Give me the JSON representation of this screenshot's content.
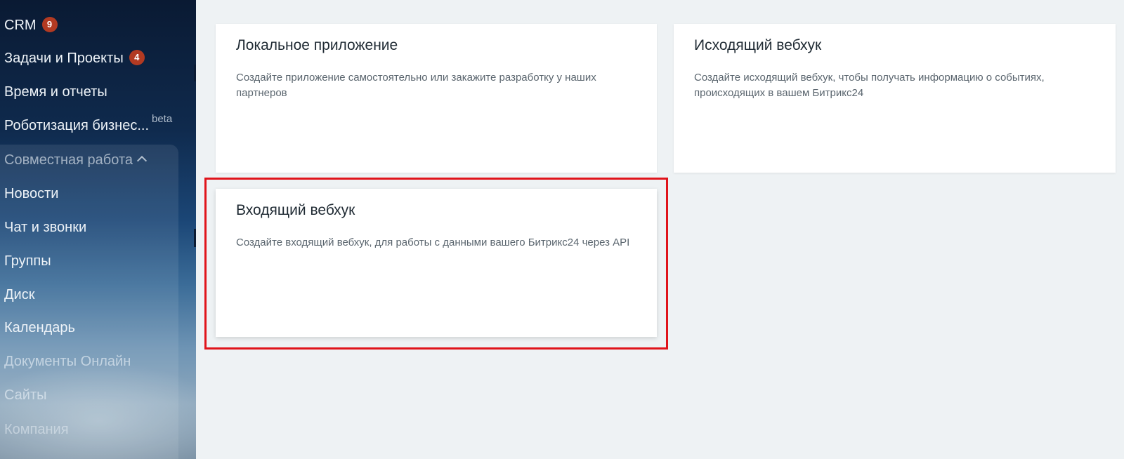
{
  "sidebar": {
    "items": [
      {
        "label": "CRM",
        "badge": "9"
      },
      {
        "label": "Задачи и Проекты",
        "badge": "4"
      },
      {
        "label": "Время и отчеты"
      },
      {
        "label": "Роботизация бизнес...",
        "tag": "beta"
      },
      {
        "label": "Совместная работа"
      },
      {
        "label": "Новости"
      },
      {
        "label": "Чат и звонки"
      },
      {
        "label": "Группы"
      },
      {
        "label": "Диск"
      },
      {
        "label": "Календарь"
      },
      {
        "label": "Документы Онлайн"
      },
      {
        "label": "Сайты"
      },
      {
        "label": "Компания"
      }
    ]
  },
  "cards": [
    {
      "title": "Локальное приложение",
      "description": "Создайте приложение самостоятельно или закажите разработку у наших партнеров"
    },
    {
      "title": "Исходящий вебхук",
      "description": "Создайте исходящий вебхук, чтобы получать информацию о событиях, происходящих в вашем Битрикс24"
    },
    {
      "title": "Входящий вебхук",
      "description": "Создайте входящий вебхук, для работы с данными вашего Битрикс24 через API"
    }
  ],
  "colors": {
    "badge": "#b23a22",
    "highlight_border": "#e0141b",
    "background": "#eef2f4"
  }
}
